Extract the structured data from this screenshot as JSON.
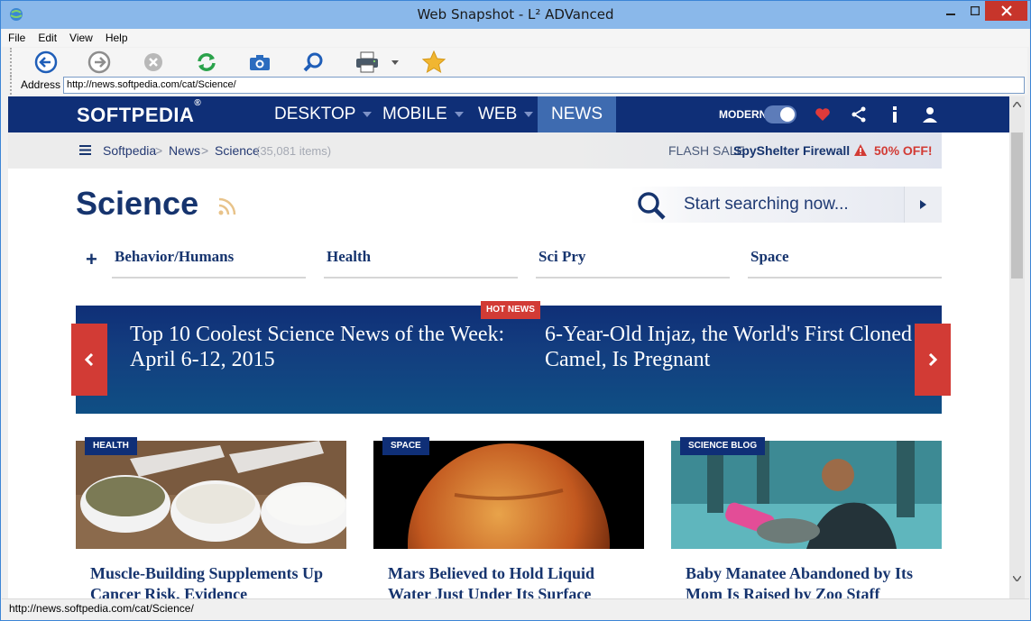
{
  "window": {
    "title": "Web Snapshot - L² ADVanced"
  },
  "menu": [
    "File",
    "Edit",
    "View",
    "Help"
  ],
  "address": {
    "label": "Address",
    "url": "http://news.softpedia.com/cat/Science/"
  },
  "status": {
    "text": "http://news.softpedia.com/cat/Science/"
  },
  "site": {
    "logo": "SOFTPEDIA",
    "logo_mark": "®",
    "nav": [
      "DESKTOP",
      "MOBILE",
      "WEB",
      "NEWS"
    ],
    "modern_label": "MODERN",
    "breadcrumb": {
      "items": [
        "Softpedia",
        "News",
        "Science"
      ],
      "count": "(35,081 items)"
    },
    "flash": {
      "label": "FLASH SALE:",
      "product": "SpyShelter Firewall",
      "offer": "50% OFF!"
    },
    "page_title": "Science",
    "search_placeholder": "Start searching now...",
    "categories": [
      "Behavior/Humans",
      "Health",
      "Sci Pry",
      "Space"
    ],
    "hero": {
      "badge": "HOT NEWS",
      "headlines": [
        "Top 10 Coolest Science News of the Week: April 6-12, 2015",
        "6-Year-Old Injaz, the World's First Cloned Camel, Is Pregnant"
      ]
    },
    "cards": [
      {
        "tag": "HEALTH",
        "title": "Muscle-Building Supplements Up Cancer Risk, Evidence"
      },
      {
        "tag": "SPACE",
        "title": "Mars Believed to Hold Liquid Water Just Under Its Surface"
      },
      {
        "tag": "SCIENCE BLOG",
        "title": "Baby Manatee Abandoned by Its Mom Is Raised by Zoo Staff"
      }
    ]
  },
  "colors": {
    "brand_navy": "#0f2f77",
    "accent_red": "#d23b35",
    "title_bar": "#8ab8ea"
  }
}
